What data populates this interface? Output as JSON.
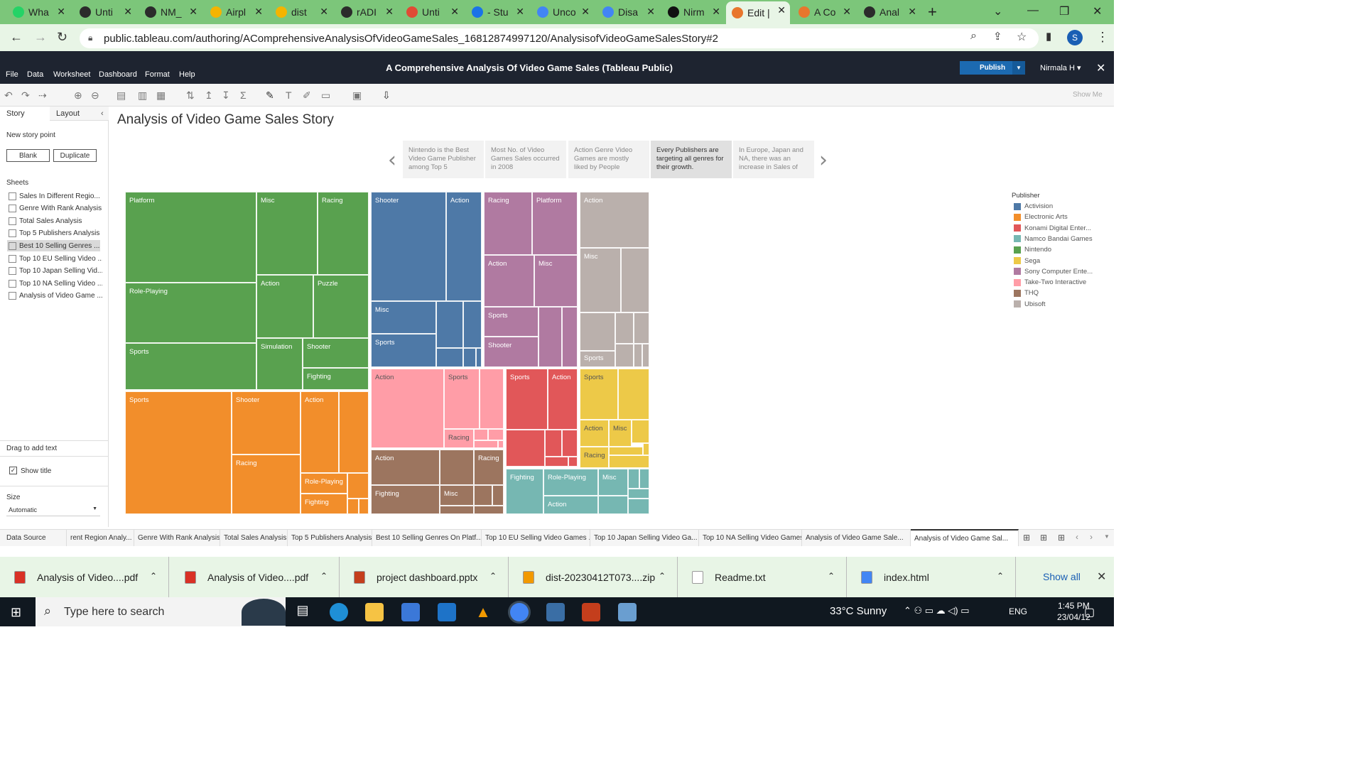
{
  "browser": {
    "tabs": [
      {
        "title": "Wha",
        "fav": "#25d366"
      },
      {
        "title": "Unti",
        "fav": "#2b2b2b"
      },
      {
        "title": "NM_",
        "fav": "#2b2b2b"
      },
      {
        "title": "Airpl",
        "fav": "#f4b400"
      },
      {
        "title": "dist",
        "fav": "#f4b400"
      },
      {
        "title": "rADI",
        "fav": "#2b2b2b"
      },
      {
        "title": "Unti",
        "fav": "#e04b35"
      },
      {
        "title": "- Stu",
        "fav": "#1a73e8"
      },
      {
        "title": "Unco",
        "fav": "#4285f4"
      },
      {
        "title": "Disa",
        "fav": "#4285f4"
      },
      {
        "title": "Nirm",
        "fav": "#111111"
      },
      {
        "title": "Edit |",
        "fav": "#e8762d"
      },
      {
        "title": "A Co",
        "fav": "#e8762d"
      },
      {
        "title": "Anal",
        "fav": "#2b2b2b"
      }
    ],
    "url": "public.tableau.com/authoring/AComprehensiveAnalysisOfVideoGameSales_16812874997120/AnalysisofVideoGameSalesStory#2",
    "avatar": "S"
  },
  "tableau": {
    "menus": [
      "File",
      "Data",
      "Worksheet",
      "Dashboard",
      "Format",
      "Help"
    ],
    "title": "A Comprehensive Analysis Of Video Game Sales (Tableau Public)",
    "publish": "Publish",
    "user": "Nirmala H ▾",
    "show_me": "Show Me"
  },
  "left_pane": {
    "tabs": [
      "Story",
      "Layout"
    ],
    "new_story_point": "New story point",
    "blank": "Blank",
    "duplicate": "Duplicate",
    "sheets_label": "Sheets",
    "sheets": [
      "Sales In Different Regio...",
      "Genre With Rank Analysis",
      "Total Sales Analysis",
      "Top 5 Publishers Analysis",
      "Best 10 Selling Genres ...",
      "Top 10 EU Selling Video ...",
      "Top 10 Japan Selling Vid...",
      "Top 10 NA Selling Video ...",
      "Analysis of Video Game ..."
    ],
    "drag_text": "Drag to add text",
    "show_title": "Show title",
    "size_label": "Size",
    "size_value": "Automatic"
  },
  "story": {
    "title": "Analysis of Video Game Sales Story",
    "points": [
      "Nintendo is the Best Video Game Publisher among Top 5",
      "Most No. of Video Games Sales occurred in 2008",
      "Action Genre Video Games are mostly liked by People",
      "Every Publishers are targeting all genres for their growth.",
      "In Europe, Japan and NA, there was an increase in Sales of"
    ]
  },
  "legend": {
    "title": "Publisher",
    "items": [
      {
        "name": "Activision",
        "color": "#4e79a7"
      },
      {
        "name": "Electronic Arts",
        "color": "#f28e2b"
      },
      {
        "name": "Konami Digital Enter...",
        "color": "#e15759"
      },
      {
        "name": "Namco Bandai Games",
        "color": "#76b7b2"
      },
      {
        "name": "Nintendo",
        "color": "#59a14f"
      },
      {
        "name": "Sega",
        "color": "#edc948"
      },
      {
        "name": "Sony Computer Ente...",
        "color": "#b07aa1"
      },
      {
        "name": "Take-Two Interactive",
        "color": "#ff9da7"
      },
      {
        "name": "THQ",
        "color": "#9c755f"
      },
      {
        "name": "Ubisoft",
        "color": "#bab0ac"
      }
    ]
  },
  "treemap_labels": {
    "n_platform": "Platform",
    "n_misc": "Misc",
    "n_racing": "Racing",
    "n_rpg": "Role-Playing",
    "n_action": "Action",
    "n_puzzle": "Puzzle",
    "n_sports": "Sports",
    "n_sim": "Simulation",
    "n_shooter": "Shooter",
    "n_fighting": "Fighting",
    "ea_sports": "Sports",
    "ea_shooter": "Shooter",
    "ea_action": "Action",
    "ea_racing": "Racing",
    "ea_rpg": "Role-Playing",
    "ea_fighting": "Fighting",
    "a_shooter": "Shooter",
    "a_action": "Action",
    "a_misc": "Misc",
    "a_sports": "Sports",
    "s_racing": "Racing",
    "s_platform": "Platform",
    "s_action": "Action",
    "s_misc": "Misc",
    "s_sports": "Sports",
    "s_shooter": "Shooter",
    "u_action": "Action",
    "u_misc": "Misc",
    "u_sports": "Sports",
    "t_action": "Action",
    "t_sports": "Sports",
    "t_racing": "Racing",
    "k_sports": "Sports",
    "k_action": "Action",
    "g_sports": "Sports",
    "g_action": "Action",
    "g_misc": "Misc",
    "g_racing": "Racing",
    "h_action": "Action",
    "h_racing": "Racing",
    "h_fighting": "Fighting",
    "h_misc": "Misc",
    "b_fighting": "Fighting",
    "b_rpg": "Role-Playing",
    "b_misc": "Misc",
    "b_action": "Action"
  },
  "sheet_tabs": [
    "Data Source",
    "rent Region Analy...",
    "Genre With Rank Analysis",
    "Total Sales Analysis",
    "Top 5 Publishers Analysis",
    "Best 10 Selling Genres On Platf...",
    "Top 10 EU Selling Video Games ...",
    "Top 10 Japan Selling Video Ga...",
    "Top 10 NA Selling Video Games",
    "Analysis of Video Game Sale...",
    "Analysis of Video Game Sal..."
  ],
  "downloads": [
    {
      "name": "Analysis of Video....pdf",
      "color": "#d93025"
    },
    {
      "name": "Analysis of Video....pdf",
      "color": "#d93025"
    },
    {
      "name": "project dashboard.pptx",
      "color": "#c43e1c"
    },
    {
      "name": "dist-20230412T073....zip",
      "color": "#f29900"
    },
    {
      "name": "Readme.txt",
      "color": "#ffffff"
    },
    {
      "name": "index.html",
      "color": "#4285f4"
    }
  ],
  "show_all": "Show all",
  "taskbar": {
    "search_placeholder": "Type here to search",
    "weather": "33°C  Sunny",
    "lang": "ENG",
    "time": "1:45 PM",
    "date": "23/04/12"
  }
}
